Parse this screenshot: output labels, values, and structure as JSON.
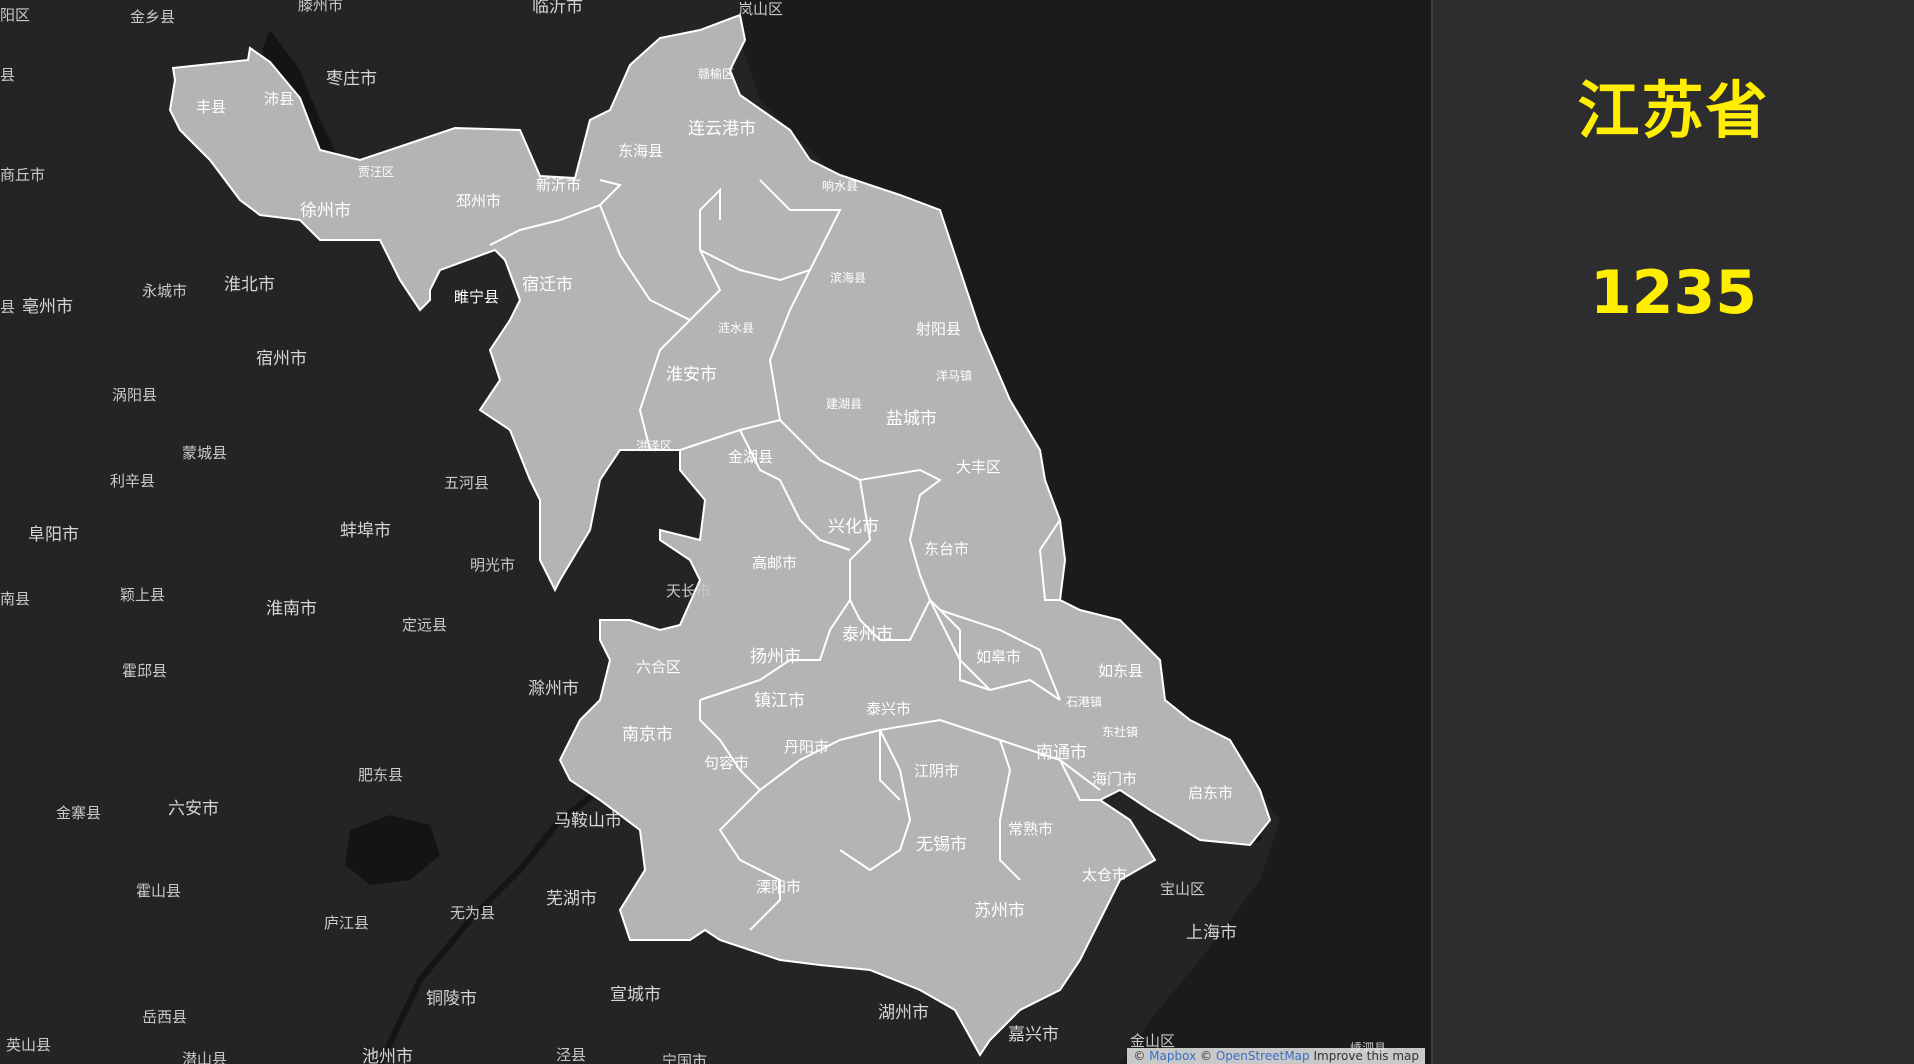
{
  "panel": {
    "title": "江苏省",
    "value": "1235"
  },
  "map": {
    "highlight_color": "#b4b4b4",
    "boundary_color": "#ffffff",
    "water_color": "#1b1b1d",
    "land_color": "#262628",
    "labels": {
      "l_0": "阳区",
      "l_1": "金乡县",
      "l_2": "滕州市",
      "l_3": "临沂市",
      "l_4": "岚山区",
      "l_5": "县",
      "l_6": "枣庄市",
      "l_7": "商丘市",
      "l_8": "永城市",
      "l_9": "淮北市",
      "l_10": "县",
      "l_11": "亳州市",
      "l_12": "宿州市",
      "l_13": "涡阳县",
      "l_14": "蒙城县",
      "l_15": "利辛县",
      "l_16": "五河县",
      "l_17": "阜阳市",
      "l_18": "蚌埠市",
      "l_19": "明光市",
      "l_20": "南县",
      "l_21": "颖上县",
      "l_22": "淮南市",
      "l_23": "定远县",
      "l_24": "天长市",
      "l_25": "霍邱县",
      "l_26": "滁州市",
      "l_27": "肥东县",
      "l_28": "金寨县",
      "l_29": "六安市",
      "l_30": "马鞍山市",
      "l_31": "霍山县",
      "l_32": "庐江县",
      "l_33": "无为县",
      "l_34": "芜湖市",
      "l_35": "铜陵市",
      "l_36": "宣城市",
      "l_37": "岳西县",
      "l_38": "英山县",
      "l_39": "潜山县",
      "l_40": "池州市",
      "l_41": "泾县",
      "l_42": "宁国市",
      "l_43": "湖州市",
      "l_44": "嘉兴市",
      "l_45": "金山区",
      "l_46": "上海市",
      "l_47": "宝山区",
      "l_48": "嵊泗县",
      "l_49": "丰县",
      "l_50": "沛县",
      "l_51": "贾汪区",
      "l_52": "徐州市",
      "l_53": "邳州市",
      "l_54": "新沂市",
      "l_55": "赣榆区",
      "l_56": "连云港市",
      "l_57": "东海县",
      "l_58": "响水县",
      "l_59": "宿迁市",
      "l_60": "睢宁县",
      "l_61": "滨海县",
      "l_62": "涟水县",
      "l_63": "射阳县",
      "l_64": "淮安市",
      "l_65": "洋马镇",
      "l_66": "建湖县",
      "l_67": "盐城市",
      "l_68": "洪泽区",
      "l_69": "金湖县",
      "l_70": "大丰区",
      "l_71": "兴化市",
      "l_72": "高邮市",
      "l_73": "东台市",
      "l_74": "泰州市",
      "l_75": "如皋市",
      "l_76": "扬州市",
      "l_77": "六合区",
      "l_78": "如东县",
      "l_79": "镇江市",
      "l_80": "石港镇",
      "l_81": "泰兴市",
      "l_82": "南京市",
      "l_83": "东社镇",
      "l_84": "丹阳市",
      "l_85": "南通市",
      "l_86": "句容市",
      "l_87": "江阴市",
      "l_88": "海门市",
      "l_89": "启东市",
      "l_90": "常熟市",
      "l_91": "无锡市",
      "l_92": "溧阳市",
      "l_93": "太仓市",
      "l_94": "苏州市"
    }
  },
  "attribution": {
    "copy1": "© ",
    "mapbox": "Mapbox",
    "copy2": " © ",
    "osm": "OpenStreetMap",
    "improve": " Improve this map"
  }
}
